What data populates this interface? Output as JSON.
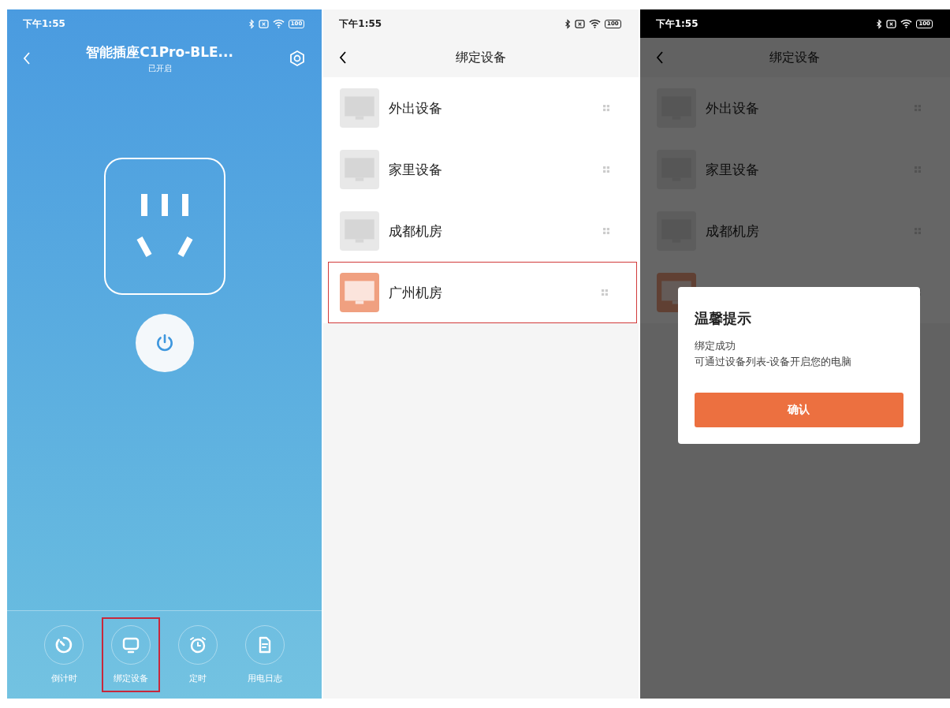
{
  "screens": [
    {
      "kind": "plug",
      "status_bar": {
        "time": "下午1:55",
        "battery": "100"
      },
      "header": {
        "title": "智能插座C1Pro-BLE...",
        "subtitle": "已开启"
      },
      "actions": [
        {
          "kind": "countdown",
          "label": "倒计时",
          "outlined": false
        },
        {
          "kind": "monitor",
          "label": "绑定设备",
          "outlined": true
        },
        {
          "kind": "alarm",
          "label": "定时",
          "outlined": false
        },
        {
          "kind": "log",
          "label": "用电日志",
          "outlined": false
        }
      ]
    },
    {
      "kind": "list",
      "status_bar": {
        "time": "下午1:55",
        "battery": "100"
      },
      "header": {
        "title": "绑定设备"
      },
      "devices": [
        {
          "name": "外出设备",
          "active": false,
          "outlined": false
        },
        {
          "name": "家里设备",
          "active": false,
          "outlined": false
        },
        {
          "name": "成都机房",
          "active": false,
          "outlined": false
        },
        {
          "name": "广州机房",
          "active": true,
          "outlined": true
        }
      ]
    },
    {
      "kind": "dialog",
      "status_bar": {
        "time": "下午1:55",
        "battery": "100"
      },
      "header": {
        "title": "绑定设备"
      },
      "devices": [
        {
          "name": "外出设备",
          "active": false,
          "outlined": false
        },
        {
          "name": "家里设备",
          "active": false,
          "outlined": false
        },
        {
          "name": "成都机房",
          "active": false,
          "outlined": false
        },
        {
          "active": true,
          "outlined": false
        }
      ],
      "dialog": {
        "title": "温馨提示",
        "message": [
          "绑定成功",
          "可通过设备列表-设备开启您的电脑"
        ],
        "button": "确认"
      }
    }
  ]
}
